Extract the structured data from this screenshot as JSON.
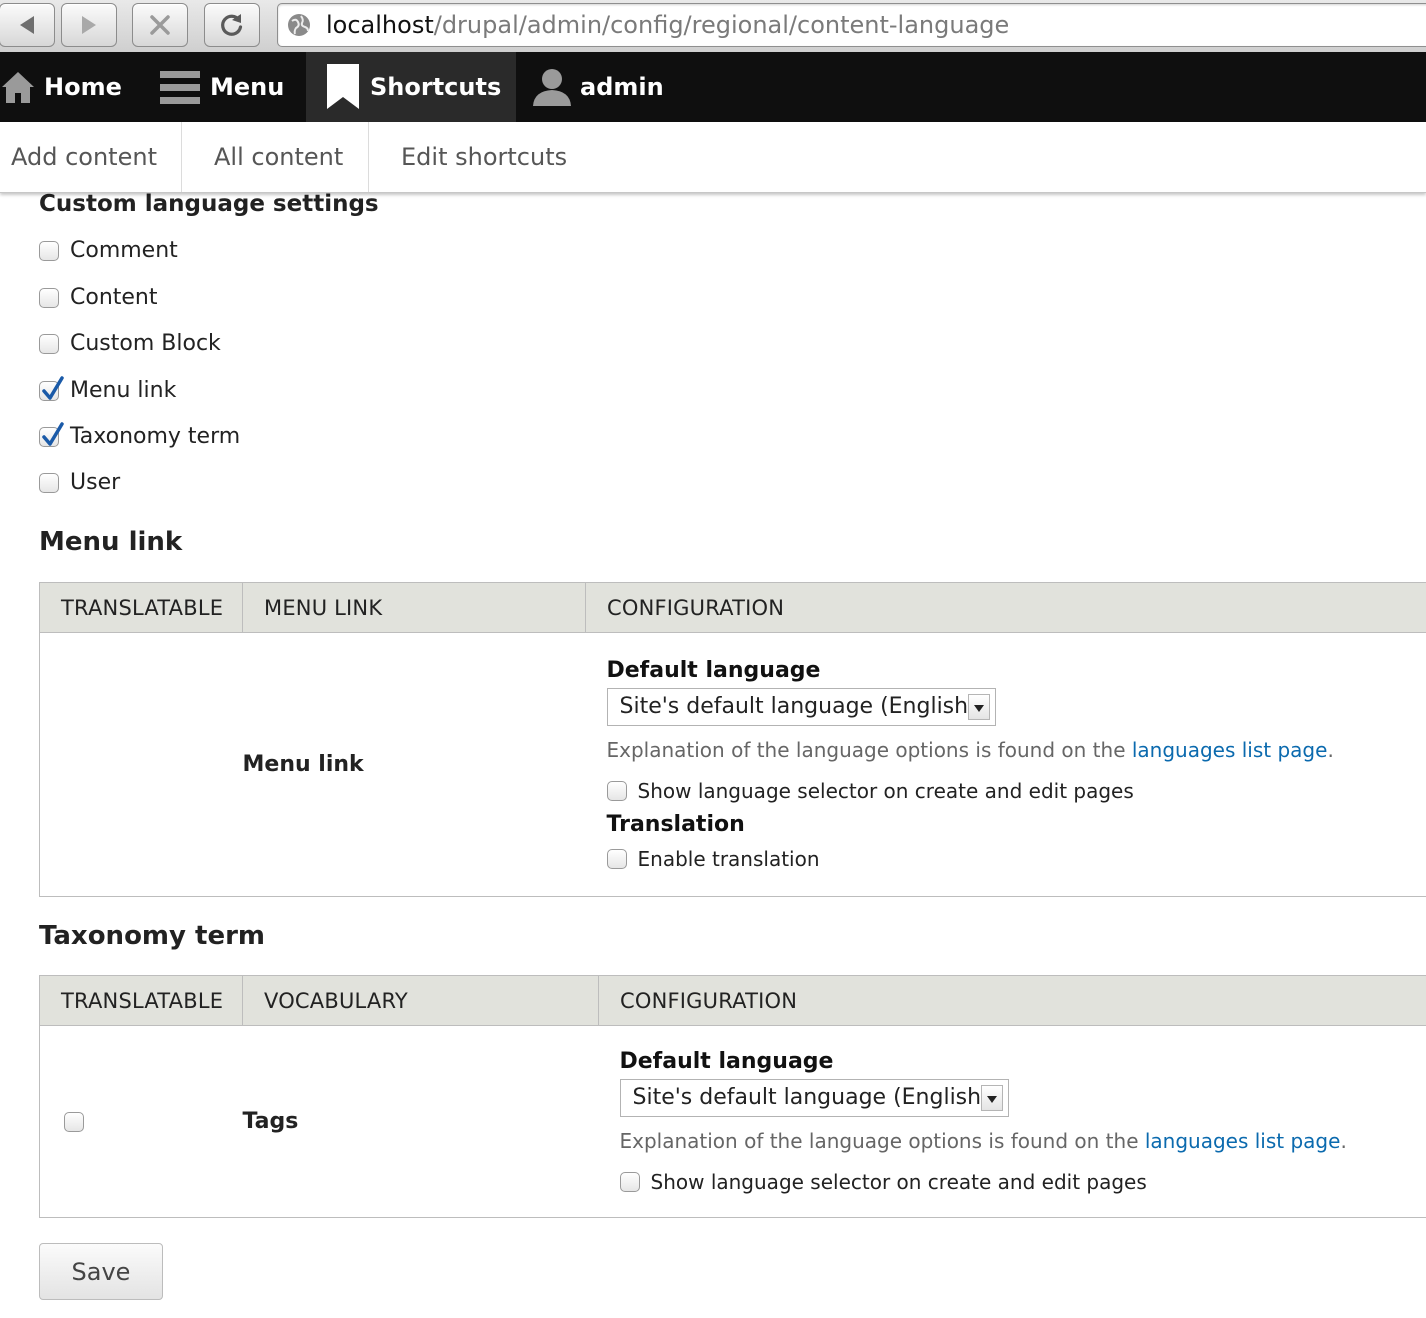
{
  "browser": {
    "url_host": "localhost",
    "url_path": "/drupal/admin/config/regional/content-language",
    "buttons": [
      "back-icon",
      "forward-icon",
      "stop-icon",
      "reload-icon"
    ]
  },
  "toolbar": {
    "items": [
      {
        "label": "Home",
        "icon": "home-icon"
      },
      {
        "label": "Menu",
        "icon": "menu-icon"
      },
      {
        "label": "Shortcuts",
        "icon": "bookmark-icon",
        "active": true
      },
      {
        "label": "admin",
        "icon": "user-icon"
      }
    ]
  },
  "shortcuts_tray": [
    "Add content",
    "All content",
    "Edit shortcuts"
  ],
  "custom_settings": {
    "title": "Custom language settings",
    "entities": [
      {
        "label": "Comment",
        "checked": false
      },
      {
        "label": "Content",
        "checked": false
      },
      {
        "label": "Custom Block",
        "checked": false
      },
      {
        "label": "Menu link",
        "checked": true
      },
      {
        "label": "Taxonomy term",
        "checked": true
      },
      {
        "label": "User",
        "checked": false
      }
    ]
  },
  "menu_link_section": {
    "title": "Menu link",
    "headers": [
      "Translatable",
      "Menu link",
      "Configuration"
    ],
    "row": {
      "name": "Menu link",
      "default_language_label": "Default language",
      "select_value": "Site's default language (English)",
      "explanation_prefix": "Explanation of the language options is found on the ",
      "explanation_link": "languages list page",
      "explanation_suffix": ".",
      "show_selector_label": "Show language selector on create and edit pages",
      "translation_label": "Translation",
      "enable_translation_label": "Enable translation"
    }
  },
  "taxonomy_section": {
    "title": "Taxonomy term",
    "headers": [
      "Translatable",
      "Vocabulary",
      "Configuration"
    ],
    "row": {
      "name": "Tags",
      "translatable_checked": false,
      "default_language_label": "Default language",
      "select_value": "Site's default language (English)",
      "explanation_prefix": "Explanation of the language options is found on the ",
      "explanation_link": "languages list page",
      "explanation_suffix": ".",
      "show_selector_label": "Show language selector on create and edit pages"
    }
  },
  "save_label": "Save",
  "colors": {
    "toolbar_bg": "#0f0f0f",
    "table_header_bg": "#e1e2dc",
    "link": "#0b6aae",
    "checkbox_check": "#1a5aa8"
  }
}
